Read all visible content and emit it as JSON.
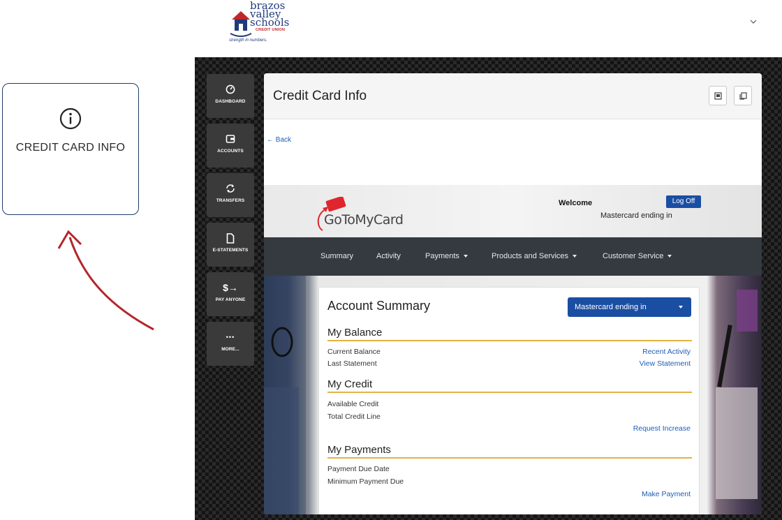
{
  "brand": {
    "logo_line1": "brazos",
    "logo_line2": "valley",
    "logo_line3": "schools",
    "logo_sub": "CREDIT UNION",
    "logo_tagline": "strength in numbers."
  },
  "callout": {
    "label": "CREDIT CARD INFO",
    "icon": "info-circle-icon"
  },
  "sidenav": {
    "items": [
      {
        "label": "DASHBOARD",
        "icon": "gauge-icon"
      },
      {
        "label": "ACCOUNTS",
        "icon": "wallet-icon"
      },
      {
        "label": "TRANSFERS",
        "icon": "refresh-icon"
      },
      {
        "label": "E-STATEMENTS",
        "icon": "document-icon"
      },
      {
        "label": "PAY ANYONE",
        "icon": "dollar-arrow-icon",
        "glyph": "$→"
      },
      {
        "label": "MORE...",
        "icon": "ellipsis-icon",
        "glyph": "•••"
      }
    ]
  },
  "panel": {
    "title": "Credit Card Info",
    "back_label": "← Back"
  },
  "card_site": {
    "logo_text": "GoToMyCard",
    "welcome": "Welcome",
    "logoff": "Log Off",
    "card_ending": "Mastercard ending in",
    "nav": [
      "Summary",
      "Activity",
      "Payments",
      "Products and Services",
      "Customer Service"
    ]
  },
  "summary": {
    "title": "Account Summary",
    "selector": "Mastercard ending in",
    "balance": {
      "heading": "My Balance",
      "current": "Current Balance",
      "last": "Last Statement",
      "recent_link": "Recent Activity",
      "statement_link": "View Statement"
    },
    "credit": {
      "heading": "My Credit",
      "available": "Available Credit",
      "total": "Total Credit Line",
      "increase_link": "Request Increase"
    },
    "payments": {
      "heading": "My Payments",
      "due_date": "Payment Due Date",
      "min_due": "Minimum Payment Due",
      "pay_link": "Make Payment"
    }
  },
  "colors": {
    "navy": "#1f3b66",
    "accent_blue": "#1a4ea3",
    "link_blue": "#1c5eb8",
    "gold_rule": "#e3b341",
    "arrow_red": "#b3262b",
    "dark_nav": "#343a40"
  }
}
